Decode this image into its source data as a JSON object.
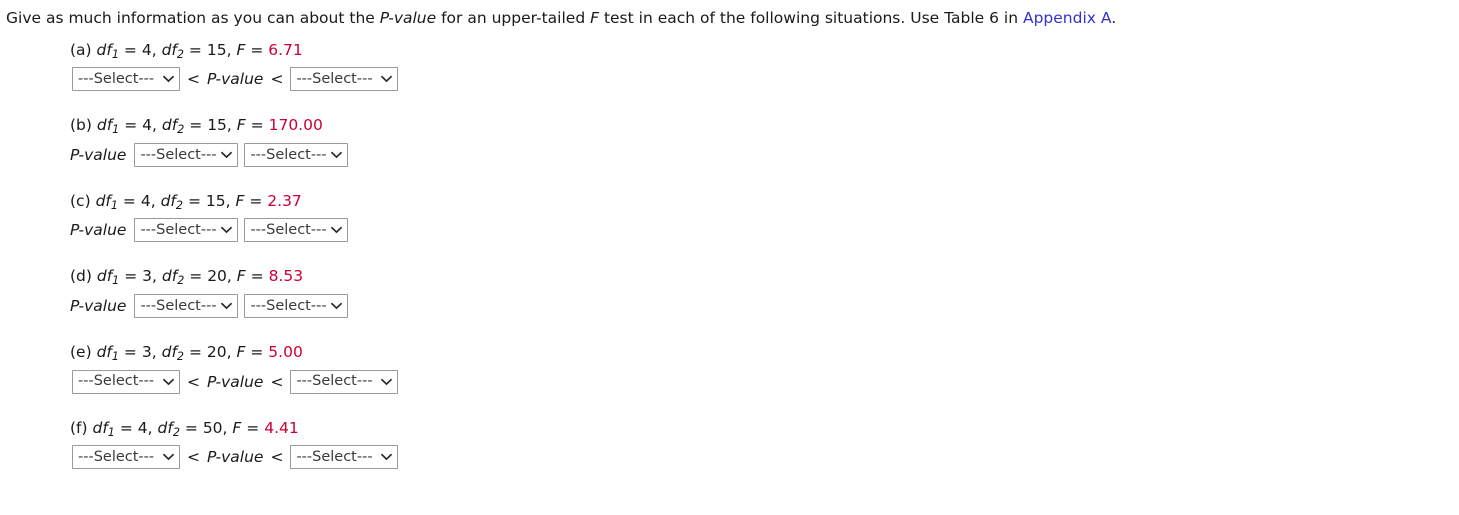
{
  "prompt": {
    "text_before_link": "Give as much information as you can about the P-value for an upper-tailed F test in each of the following situations. Use Table 6 in ",
    "segment_1": "Give as much information as you can about the ",
    "pvalue_italic": "P-value",
    "segment_2": " for an upper-tailed ",
    "f_italic": "F",
    "segment_3": " test in each of the following situations. Use Table 6 in ",
    "link_label": "Appendix A",
    "period": "."
  },
  "labels": {
    "df": "df",
    "equals": "=",
    "comma": ",",
    "f_symbol": "F",
    "pvalue": "P-value",
    "less_than": "<",
    "select_placeholder": "---Select---"
  },
  "colors": {
    "f_value": "#cc0033",
    "link": "#3333cc",
    "text": "#1a1a1a",
    "select_border": "#9a9a9a",
    "select_text": "#3a3a3a",
    "background": "#ffffff"
  },
  "select_options": [
    "---Select---"
  ],
  "items": [
    {
      "label": "(a)",
      "df1": "4",
      "df2": "15",
      "f_value": "6.71",
      "answer_type": "inequality",
      "select_left_value": "---Select---",
      "select_right_value": "---Select---",
      "operator_left": "<",
      "operator_right": "<",
      "middle_label": "P-value"
    },
    {
      "label": "(b)",
      "df1": "4",
      "df2": "15",
      "f_value": "170.00",
      "answer_type": "prefix",
      "prefix_label": "P-value",
      "select_left_value": "---Select---",
      "select_right_value": "---Select---"
    },
    {
      "label": "(c)",
      "df1": "4",
      "df2": "15",
      "f_value": "2.37",
      "answer_type": "prefix",
      "prefix_label": "P-value",
      "select_left_value": "---Select---",
      "select_right_value": "---Select---"
    },
    {
      "label": "(d)",
      "df1": "3",
      "df2": "20",
      "f_value": "8.53",
      "answer_type": "prefix",
      "prefix_label": "P-value",
      "select_left_value": "---Select---",
      "select_right_value": "---Select---"
    },
    {
      "label": "(e)",
      "df1": "3",
      "df2": "20",
      "f_value": "5.00",
      "answer_type": "inequality",
      "select_left_value": "---Select---",
      "select_right_value": "---Select---",
      "operator_left": "<",
      "operator_right": "<",
      "middle_label": "P-value"
    },
    {
      "label": "(f)",
      "df1": "4",
      "df2": "50",
      "f_value": "4.41",
      "answer_type": "inequality",
      "select_left_value": "---Select---",
      "select_right_value": "---Select---",
      "operator_left": "<",
      "operator_right": "<",
      "middle_label": "P-value"
    }
  ]
}
